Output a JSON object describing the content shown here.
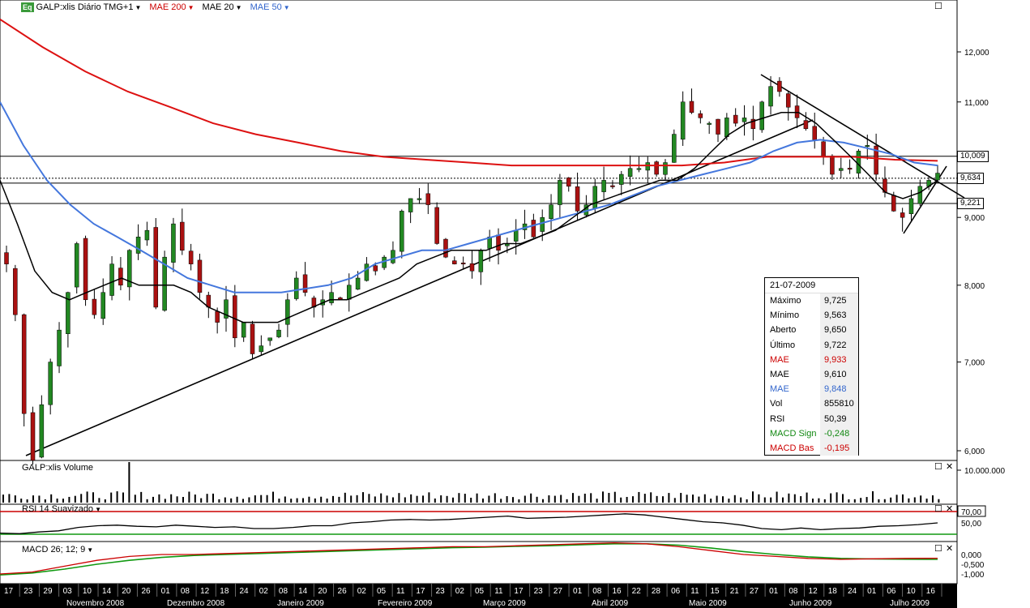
{
  "legend": {
    "badge": "Eq",
    "symbol": "GALP:xlis Diário TMG+1",
    "items": [
      {
        "label": "MAE 200",
        "color": "#cc0000"
      },
      {
        "label": "MAE 20",
        "color": "#000000"
      },
      {
        "label": "MAE 50",
        "color": "#3366cc"
      }
    ]
  },
  "panes": {
    "volume_title": "GALP:xlis Volume",
    "rsi_title": "RSI 14 Suavizado",
    "macd_title": "MACD 26; 12; 9"
  },
  "price_tags": {
    "p1": "10,009",
    "p2": "9,634",
    "p3": "9,221"
  },
  "info_box": {
    "date": "21-07-2009",
    "rows": [
      {
        "k": "Máximo",
        "v": "9,725",
        "color": "#000000"
      },
      {
        "k": "Mínimo",
        "v": "9,563",
        "color": "#000000"
      },
      {
        "k": "Aberto",
        "v": "9,650",
        "color": "#000000"
      },
      {
        "k": "Último",
        "v": "9,722",
        "color": "#000000"
      },
      {
        "k": "MAE",
        "v": "9,933",
        "color": "#cc0000"
      },
      {
        "k": "MAE",
        "v": "9,610",
        "color": "#000000"
      },
      {
        "k": "MAE",
        "v": "9,848",
        "color": "#3366cc"
      },
      {
        "k": "Vol",
        "v": "855810",
        "color": "#000000"
      },
      {
        "k": "RSI",
        "v": "50,39",
        "color": "#000000"
      },
      {
        "k": "MACD Sign",
        "v": "-0,248",
        "color": "#118811"
      },
      {
        "k": "MACD Bas",
        "v": "-0,195",
        "color": "#cc0000"
      }
    ]
  },
  "colors": {
    "ma200": "#dd1111",
    "ma20": "#000000",
    "ma50": "#4477dd",
    "up": "#228822",
    "down": "#aa1111",
    "rsi_upper": "#cc0000",
    "rsi_lower": "#119911"
  },
  "chart_data": {
    "type": "candlestick",
    "price_axis": {
      "ticks": [
        "12,000",
        "11,000",
        "10,000",
        "9,000",
        "8,000",
        "7,000",
        "6,000"
      ],
      "scale": "log"
    },
    "volume_axis": {
      "ticks": [
        "10.000.000"
      ]
    },
    "rsi_axis": {
      "ticks": [
        "70,00",
        "50,00"
      ],
      "upper": 70,
      "lower": 30
    },
    "macd_axis": {
      "ticks": [
        "0,000",
        "-0,500",
        "-1,000"
      ]
    },
    "day_ticks": [
      "17",
      "23",
      "29",
      "03",
      "10",
      "14",
      "20",
      "26",
      "01",
      "08",
      "12",
      "18",
      "24",
      "02",
      "08",
      "14",
      "20",
      "26",
      "02",
      "05",
      "11",
      "17",
      "23",
      "02",
      "05",
      "11",
      "17",
      "23",
      "27",
      "01",
      "08",
      "16",
      "22",
      "28",
      "06",
      "11",
      "15",
      "21",
      "27",
      "01",
      "08",
      "12",
      "18",
      "24",
      "01",
      "06",
      "10",
      "16"
    ],
    "months": [
      "Novembro 2008",
      "Dezembro 2008",
      "Janeiro 2009",
      "Fevereiro 2009",
      "Março 2009",
      "Abril 2009",
      "Maio 2009",
      "Junho 2009",
      "Julho 2009"
    ],
    "horizontal_levels": [
      10.009,
      9.634,
      9.221
    ],
    "close_series": [
      8.3,
      7.6,
      6.4,
      5.9,
      6.5,
      7.0,
      7.4,
      7.9,
      8.6,
      7.8,
      7.6,
      7.9,
      8.3,
      8.0,
      8.5,
      8.7,
      8.8,
      7.7,
      8.4,
      8.9,
      8.5,
      8.3,
      7.9,
      7.7,
      7.5,
      7.8,
      7.3,
      7.5,
      7.1,
      7.2,
      7.3,
      7.4,
      7.8,
      8.1,
      7.9,
      7.7,
      7.8,
      7.9,
      7.8,
      8.0,
      8.1,
      8.3,
      8.2,
      8.4,
      8.5,
      9.1,
      9.3,
      9.3,
      9.2,
      8.6,
      8.4,
      8.3,
      8.3,
      8.2,
      8.5,
      8.7,
      8.5,
      8.6,
      8.8,
      8.9,
      8.7,
      9.0,
      9.2,
      9.6,
      9.5,
      9.1,
      9.2,
      9.5,
      9.6,
      9.5,
      9.7,
      9.8,
      9.8,
      9.9,
      9.7,
      9.9,
      10.4,
      11.0,
      10.8,
      10.7,
      10.6,
      10.4,
      10.7,
      10.6,
      10.7,
      10.5,
      11.0,
      11.3,
      11.2,
      10.9,
      10.7,
      10.5,
      10.3,
      10.0,
      9.7,
      9.8,
      9.8,
      10.1,
      10.2,
      9.7,
      9.4,
      9.1,
      9.0,
      9.3,
      9.5,
      9.6,
      9.72
    ],
    "ma20_series": [
      9.6,
      8.9,
      8.2,
      7.9,
      7.8,
      7.9,
      8.0,
      8.1,
      8.0,
      8.0,
      8.0,
      7.9,
      7.7,
      7.6,
      7.5,
      7.5,
      7.5,
      7.6,
      7.7,
      7.8,
      7.8,
      7.9,
      8.0,
      8.1,
      8.3,
      8.4,
      8.5,
      8.5,
      8.5,
      8.6,
      8.6,
      8.7,
      8.8,
      9.0,
      9.2,
      9.3,
      9.4,
      9.5,
      9.6,
      9.6,
      9.8,
      10.1,
      10.4,
      10.6,
      10.7,
      10.8,
      10.8,
      10.6,
      10.3,
      10.0,
      9.7,
      9.4,
      9.3,
      9.4,
      9.6
    ],
    "ma50_series": [
      11.0,
      10.2,
      9.6,
      9.2,
      8.9,
      8.7,
      8.5,
      8.3,
      8.1,
      8.0,
      7.9,
      7.9,
      7.9,
      7.95,
      8.0,
      8.1,
      8.3,
      8.4,
      8.5,
      8.5,
      8.6,
      8.7,
      8.8,
      8.9,
      9.0,
      9.1,
      9.2,
      9.35,
      9.5,
      9.6,
      9.7,
      9.8,
      9.9,
      10.1,
      10.25,
      10.3,
      10.25,
      10.15,
      10.05,
      9.9,
      9.85
    ],
    "ma200_series": [
      12.7,
      12.1,
      11.6,
      11.2,
      10.9,
      10.6,
      10.4,
      10.25,
      10.1,
      10.0,
      9.95,
      9.9,
      9.85,
      9.85,
      9.85,
      9.85,
      9.85,
      9.9,
      10.0,
      10.0,
      10.0,
      9.95,
      9.93
    ],
    "rsi_series": [
      32,
      31,
      34,
      36,
      42,
      45,
      46,
      44,
      43,
      46,
      44,
      42,
      43,
      40,
      40,
      42,
      45,
      45,
      50,
      52,
      55,
      56,
      55,
      56,
      58,
      60,
      62,
      58,
      59,
      60,
      62,
      64,
      66,
      64,
      60,
      56,
      52,
      50,
      46,
      40,
      38,
      41,
      38,
      40,
      41,
      44,
      45,
      47,
      50
    ],
    "macd_line": [
      -1.0,
      -0.9,
      -0.6,
      -0.3,
      -0.1,
      0.0,
      0.0,
      0.05,
      0.1,
      0.15,
      0.2,
      0.25,
      0.3,
      0.35,
      0.4,
      0.4,
      0.45,
      0.5,
      0.55,
      0.6,
      0.55,
      0.4,
      0.2,
      0.0,
      -0.1,
      -0.2,
      -0.25,
      -0.22,
      -0.2,
      -0.19
    ],
    "macd_signal": [
      -1.05,
      -0.95,
      -0.75,
      -0.5,
      -0.3,
      -0.15,
      -0.05,
      0.0,
      0.05,
      0.1,
      0.15,
      0.2,
      0.25,
      0.3,
      0.35,
      0.38,
      0.42,
      0.45,
      0.5,
      0.55,
      0.55,
      0.48,
      0.33,
      0.15,
      0.0,
      -0.12,
      -0.2,
      -0.23,
      -0.24,
      -0.25
    ]
  }
}
